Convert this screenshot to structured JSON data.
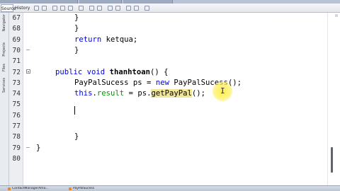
{
  "editor": {
    "tabs": {
      "source": "Source",
      "history": "History"
    },
    "side_panel": [
      "Navigator",
      "Projects",
      "Files",
      "Services"
    ],
    "lines": [
      {
        "num": "67",
        "text": "}"
      },
      {
        "num": "68",
        "text": "}"
      },
      {
        "num": "69",
        "text": "return ketqua;"
      },
      {
        "num": "70",
        "text": "}"
      },
      {
        "num": "71",
        "text": ""
      },
      {
        "num": "72",
        "text": "public void thanhtoan() {"
      },
      {
        "num": "73",
        "text": "PayPalSucess ps = new PayPalSucess();"
      },
      {
        "num": "74",
        "text": "this.result = ps.getPayPal();"
      },
      {
        "num": "75",
        "text": ""
      },
      {
        "num": "76",
        "text": ""
      },
      {
        "num": "77",
        "text": ""
      },
      {
        "num": "78",
        "text": "}"
      },
      {
        "num": "79",
        "text": "}"
      },
      {
        "num": "80",
        "text": ""
      }
    ],
    "code_parts": {
      "l69_kw": "return",
      "l69_rest": " ketqua;",
      "l72_kw": "public void",
      "l72_fn": "thanhtoan",
      "l72_rest": "() {",
      "l73_a": "PayPalSucess ps = ",
      "l73_kw": "new",
      "l73_b": " PayPalSucess();",
      "l74_kw": "this",
      "l74_dot": ".",
      "l74_fld": "result",
      "l74_mid": " = ps.",
      "l74_mth": "getPayPal",
      "l74_end": "();"
    },
    "cursor_glyph": "I"
  },
  "taskbar": {
    "items": [
      "ContactManagerAmo...",
      "PayPalSucess"
    ]
  },
  "colors": {
    "keyword": "#0000e6",
    "field": "#009900",
    "highlight": "#f2e69a"
  }
}
